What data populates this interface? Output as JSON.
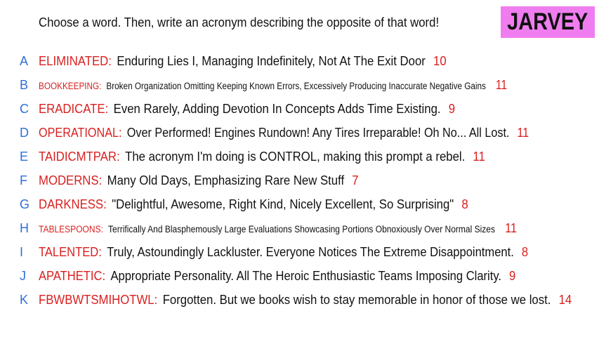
{
  "prompt": "Choose a word. Then, write an acronym describing the opposite of that word!",
  "brand": "JARVEY",
  "colors": {
    "accent_red": "#d91f1f",
    "letter_blue": "#2f6fd8",
    "brand_pink": "#f07df0",
    "text": "#111111"
  },
  "rows": [
    {
      "letter": "A",
      "word": "ELIMINATED",
      "acronym": "Enduring Lies I, Managing Indefinitely, Not At The Exit Door",
      "score": "10"
    },
    {
      "letter": "B",
      "word": "BOOKKEEPING",
      "acronym": "Broken Organization Omitting Keeping Known Errors, Excessively Producing Inaccurate Negative Gains",
      "score": "11"
    },
    {
      "letter": "C",
      "word": "ERADICATE",
      "acronym": "Even Rarely, Adding Devotion In Concepts Adds Time Existing.",
      "score": "9"
    },
    {
      "letter": "D",
      "word": "OPERATIONAL",
      "acronym": "Over Performed! Engines Rundown! Any Tires Irreparable! Oh No... All Lost.",
      "score": "11"
    },
    {
      "letter": "E",
      "word": "TAIDICMTPAR",
      "acronym": "The acronym I'm doing is CONTROL, making this prompt a rebel.",
      "score": "11"
    },
    {
      "letter": "F",
      "word": "MODERNS",
      "acronym": "Many Old Days, Emphasizing Rare New Stuff",
      "score": "7"
    },
    {
      "letter": "G",
      "word": "DARKNESS",
      "acronym": "\"Delightful, Awesome, Right Kind, Nicely Excellent, So Surprising\"",
      "score": "8"
    },
    {
      "letter": "H",
      "word": "TABLESPOONS",
      "acronym": "Terrifically And Blasphemously Large Evaluations Showcasing Portions Obnoxiously Over Normal Sizes",
      "score": "11"
    },
    {
      "letter": "I",
      "word": "TALENTED",
      "acronym": "Truly, Astoundingly Lackluster. Everyone Notices The Extreme Disappointment.",
      "score": "8"
    },
    {
      "letter": "J",
      "word": "APATHETIC",
      "acronym": "Appropriate Personality. All The Heroic Enthusiastic Teams Imposing Clarity.",
      "score": "9"
    },
    {
      "letter": "K",
      "word": "FBWBWTSMIHOTWL",
      "acronym": "Forgotten. But we books wish to stay memorable in honor of those we lost.",
      "score": "14"
    }
  ]
}
